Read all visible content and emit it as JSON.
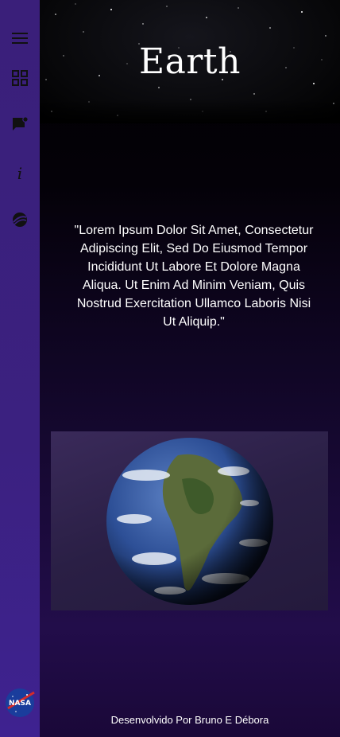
{
  "sidebar": {
    "items": [
      {
        "icon": "menu-icon"
      },
      {
        "icon": "grid-icon"
      },
      {
        "icon": "chat-notification-icon"
      },
      {
        "icon": "info-icon"
      },
      {
        "icon": "planet-icon"
      }
    ],
    "logo": {
      "icon": "nasa-logo",
      "text": "NASA"
    }
  },
  "page": {
    "title": "Earth",
    "quote": "\"Lorem Ipsum Dolor Sit Amet, Consectetur Adipiscing Elit, Sed Do Eiusmod Tempor Incididunt Ut Labore Et Dolore Magna Aliqua. Ut Enim Ad Minim Veniam, Quis Nostrud Exercitation Ullamco Laboris Nisi Ut Aliquip.\"",
    "footer": "Desenvolvido Por Bruno E Débora"
  },
  "colors": {
    "sidebar": "#3b2180",
    "background_bottom": "#220d4a",
    "text": "#ffffff"
  }
}
